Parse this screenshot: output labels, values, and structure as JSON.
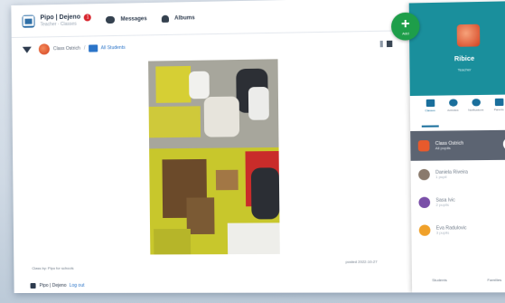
{
  "header": {
    "app_title": "Pipo | Dejeno",
    "app_subtitle": "Teacher · Classes",
    "notif_count": "1",
    "nav": [
      {
        "label": "Messages"
      },
      {
        "label": "Albums"
      }
    ]
  },
  "breadcrumb": {
    "class_name": "Class Ostrich",
    "folder_name": "All Students"
  },
  "photo": {
    "caption_left": "Class by: Pipo for schools",
    "caption_right": "posted 2022-10-27"
  },
  "footer": {
    "text": "Pipo | Dejeno",
    "link": "Log out"
  },
  "add_button": {
    "label": "Add"
  },
  "profile": {
    "name": "Ribice",
    "role": "Teacher"
  },
  "panel_tabs": [
    {
      "label": "Classes"
    },
    {
      "label": "Activities"
    },
    {
      "label": "Notifications"
    },
    {
      "label": "Parents"
    }
  ],
  "people": [
    {
      "name": "Class Ostrich",
      "sub": "All pupils",
      "color": "#e85a2c"
    },
    {
      "name": "Daniela Riveira",
      "sub": "1 pupil",
      "color": "#8a7a6c"
    },
    {
      "name": "Sasa Ivic",
      "sub": "2 pupils",
      "color": "#7a4fa8"
    },
    {
      "name": "Eva Radulovic",
      "sub": "3 pupils",
      "color": "#f0a12a"
    }
  ],
  "panel_footer": {
    "left": "Students",
    "right": "Families"
  },
  "colors": {
    "teal": "#1a8f9c",
    "add_green": "#1e9e4a",
    "link_blue": "#2b74c8",
    "notif_red": "#d8262f"
  }
}
